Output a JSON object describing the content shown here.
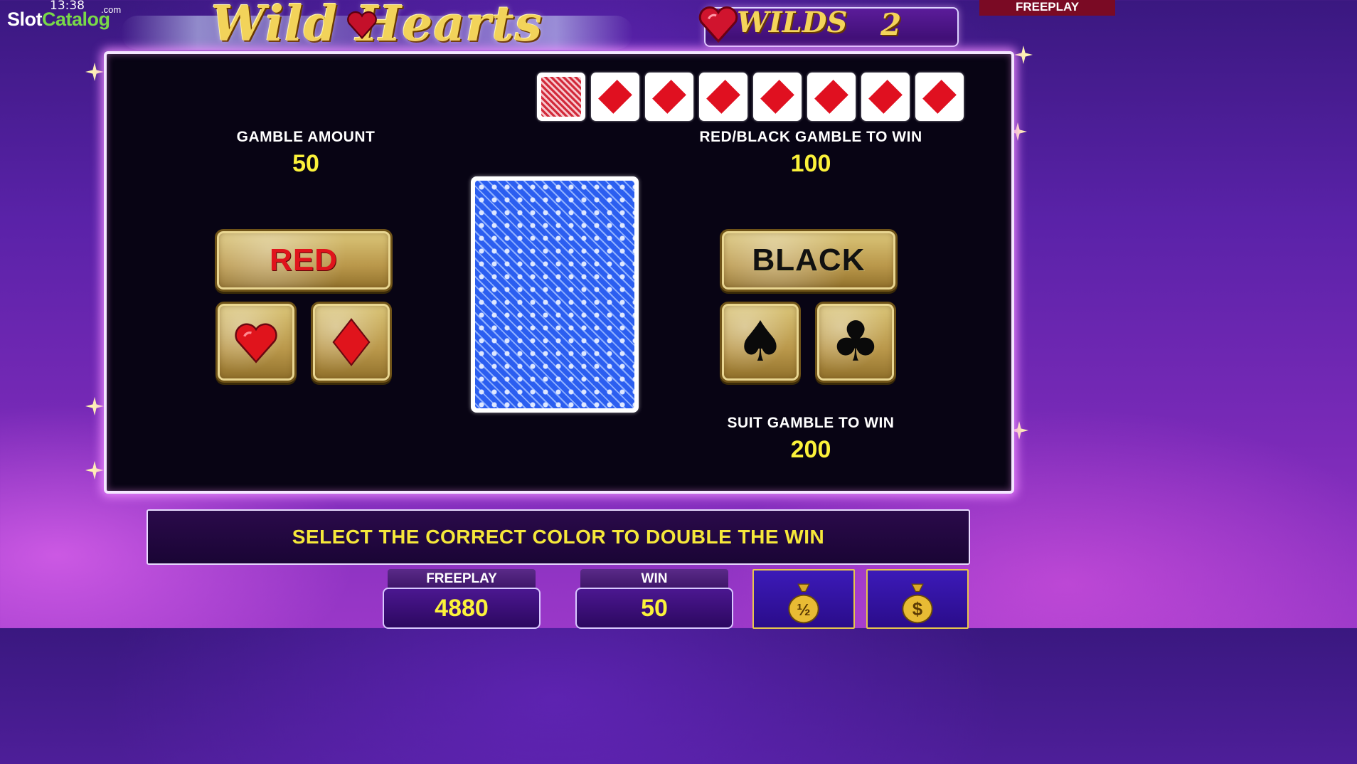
{
  "overlay": {
    "clock": "13:38",
    "logo_slot": "Slot",
    "logo_catalog": "Catalog",
    "logo_com": ".com"
  },
  "header": {
    "game_title": "Wild Hearts",
    "wilds_label": "WILDS",
    "wilds_value": "2",
    "mode_tag": "FREEPLAY"
  },
  "gamble": {
    "history": [
      {
        "type": "card-back",
        "color": "#d22a3a"
      },
      {
        "type": "suit",
        "suit": "diamond"
      },
      {
        "type": "suit",
        "suit": "diamond"
      },
      {
        "type": "suit",
        "suit": "diamond"
      },
      {
        "type": "suit",
        "suit": "diamond"
      },
      {
        "type": "suit",
        "suit": "diamond"
      },
      {
        "type": "suit",
        "suit": "diamond"
      },
      {
        "type": "suit",
        "suit": "diamond"
      }
    ],
    "gamble_amount_label": "GAMBLE AMOUNT",
    "gamble_amount_value": "50",
    "red_black_label": "RED/BLACK GAMBLE TO WIN",
    "red_black_value": "100",
    "suit_label": "SUIT GAMBLE TO WIN",
    "suit_value": "200",
    "red_button": "RED",
    "black_button": "BLACK",
    "card_back_color": "#2b5ef0"
  },
  "message": "SELECT THE CORRECT COLOR TO DOUBLE THE WIN",
  "meters": {
    "freeplay_label": "FREEPLAY",
    "freeplay_value": "4880",
    "win_label": "WIN",
    "win_value": "50"
  },
  "collect": {
    "half_icon": "money-bag-half-icon",
    "full_icon": "money-bag-dollar-icon",
    "half_glyph": "½",
    "full_glyph": "$"
  },
  "colors": {
    "accent_gold": "#f4d45a",
    "value_yellow": "#fbf23a",
    "suit_red": "#e0141c",
    "panel_border_glow": "#f08cff"
  }
}
